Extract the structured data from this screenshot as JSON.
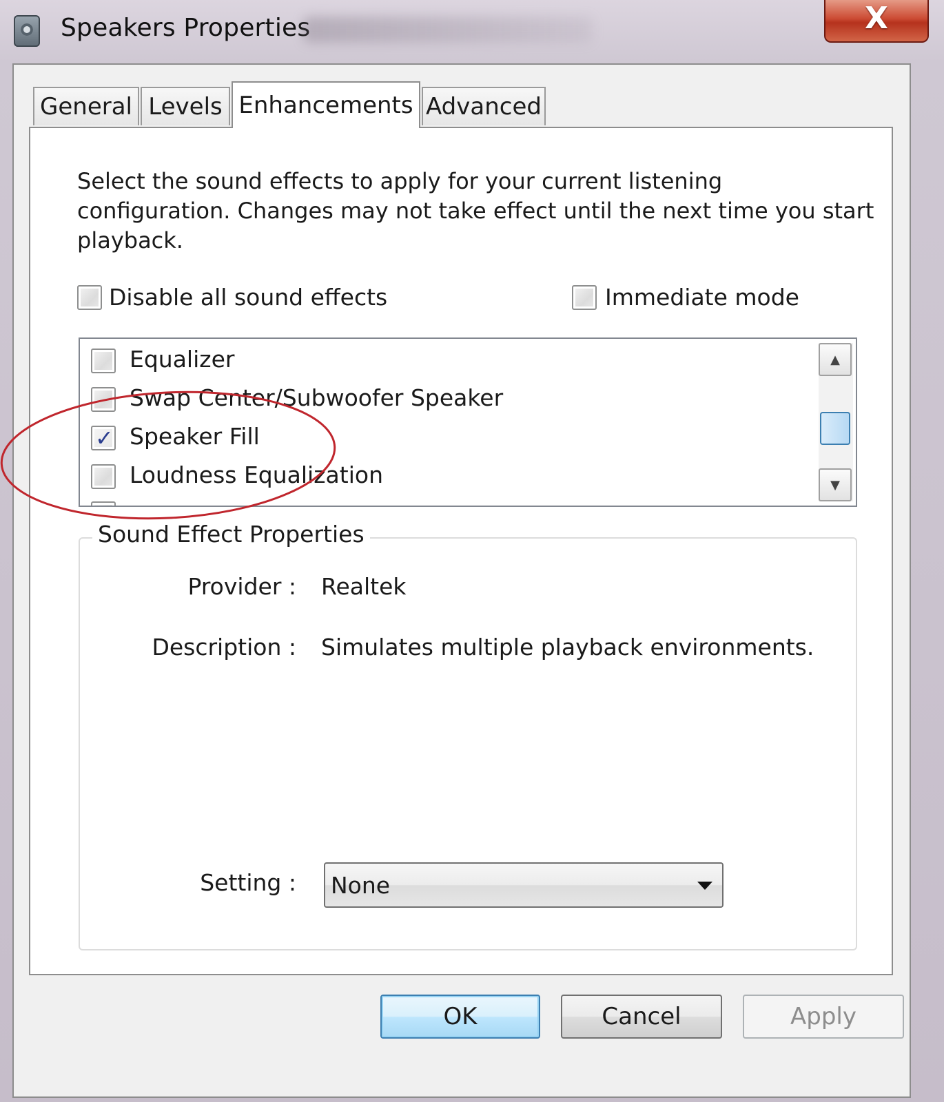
{
  "window": {
    "title": "Speakers Properties",
    "close_symbol": "X"
  },
  "tabs": [
    {
      "label": "General",
      "active": false
    },
    {
      "label": "Levels",
      "active": false
    },
    {
      "label": "Enhancements",
      "active": true
    },
    {
      "label": "Advanced",
      "active": false
    }
  ],
  "enhancements": {
    "intro_text": "Select the sound effects to apply for your current listening configuration. Changes may not take effect until the next time you start playback.",
    "disable_all": {
      "label": "Disable all sound effects",
      "checked": false
    },
    "immediate_mode": {
      "label": "Immediate mode",
      "checked": false
    },
    "effects_list": [
      {
        "label": "Equalizer",
        "checked": false
      },
      {
        "label": "Swap Center/Subwoofer Speaker",
        "checked": false
      },
      {
        "label": "Speaker Fill",
        "checked": true
      },
      {
        "label": "Loudness Equalization",
        "checked": false
      }
    ],
    "check_mark": "✓",
    "scroll_up_glyph": "▲",
    "scroll_down_glyph": "▼",
    "properties": {
      "group_title": "Sound Effect Properties",
      "provider_label": "Provider :",
      "provider_value": "Realtek",
      "description_label": "Description :",
      "description_value": "Simulates multiple playback environments.",
      "setting_label": "Setting :",
      "setting_value": "None"
    }
  },
  "buttons": {
    "ok": "OK",
    "cancel": "Cancel",
    "apply": "Apply"
  },
  "colors": {
    "annotation_circle": "#c0262d",
    "close_button": "#c9432b",
    "default_button_border": "#3c7fb1",
    "check_mark": "#2a3d8f"
  }
}
